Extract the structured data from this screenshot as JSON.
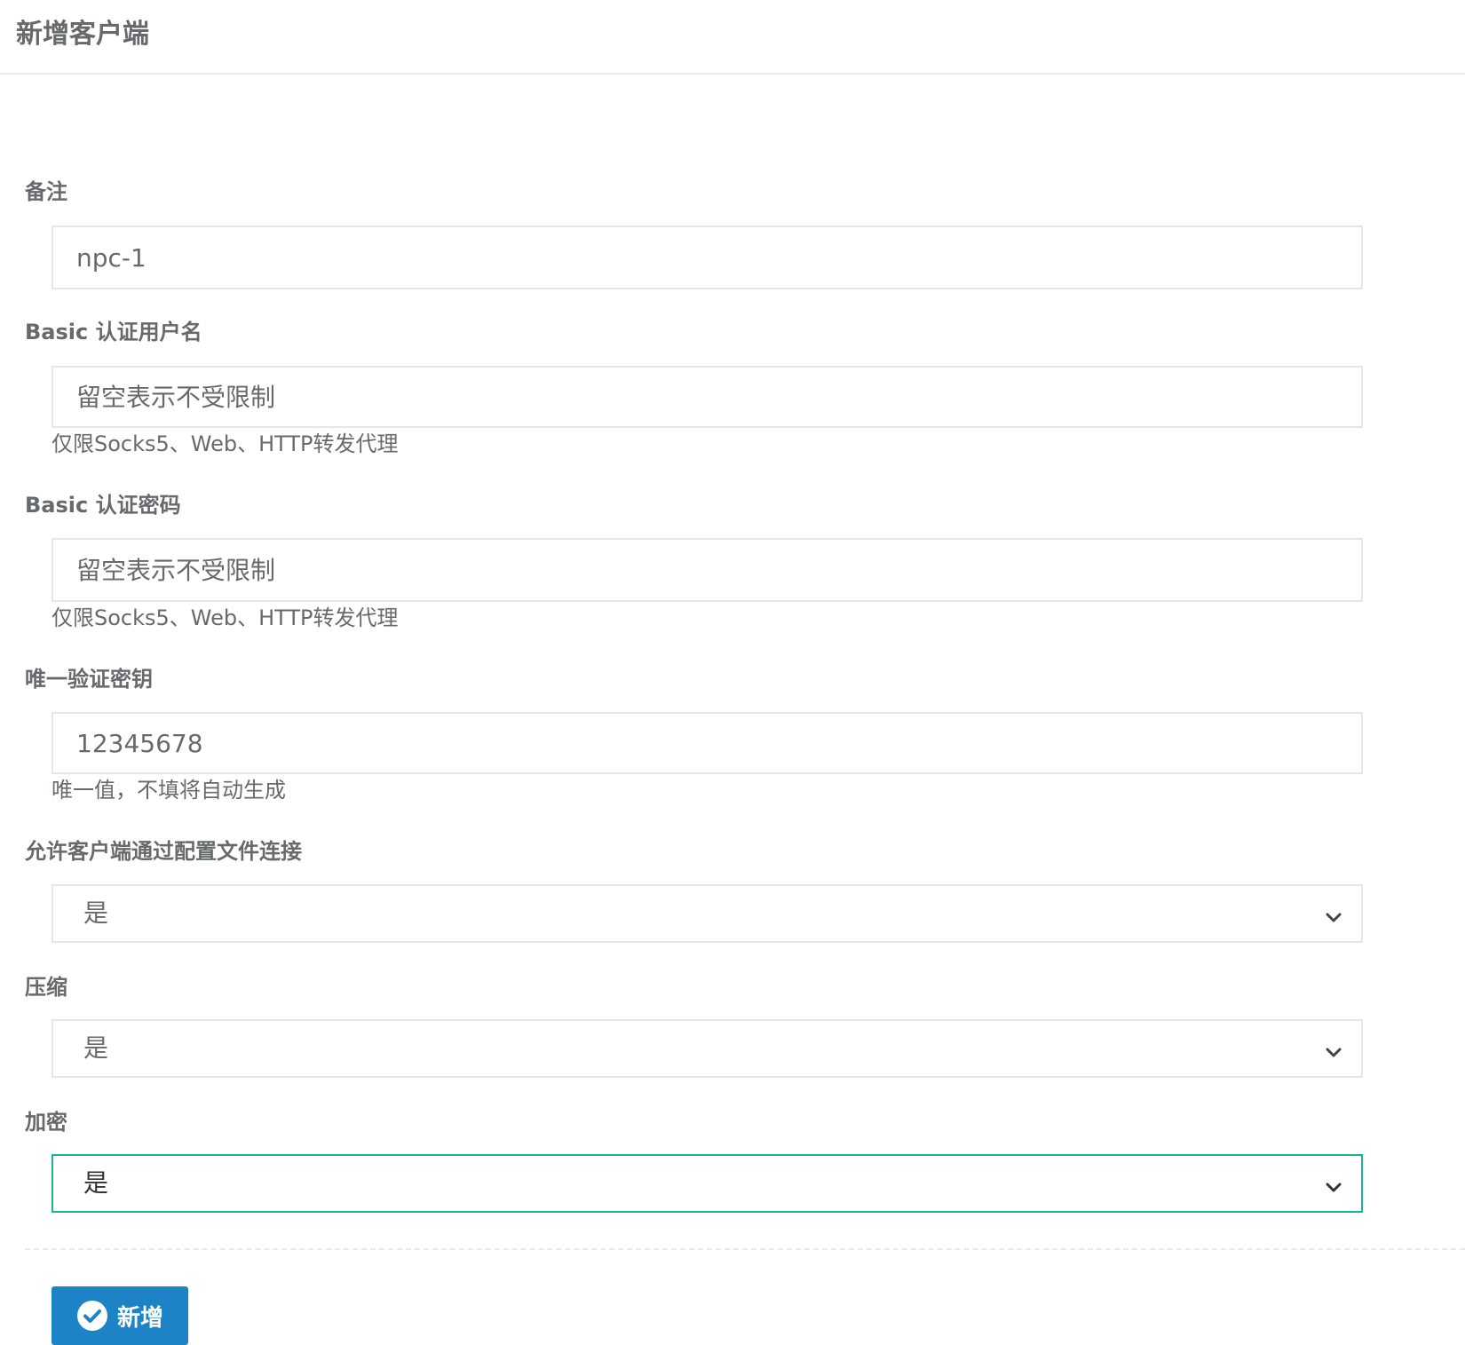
{
  "panel": {
    "title": "新增客户端"
  },
  "form": {
    "remark": {
      "label": "备注",
      "value": "npc-1"
    },
    "basic_username": {
      "label": "Basic 认证用户名",
      "placeholder": "留空表示不受限制",
      "help": "仅限Socks5、Web、HTTP转发代理"
    },
    "basic_password": {
      "label": "Basic 认证密码",
      "placeholder": "留空表示不受限制",
      "help": "仅限Socks5、Web、HTTP转发代理"
    },
    "verify_key": {
      "label": "唯一验证密钥",
      "value": "12345678",
      "help": "唯一值，不填将自动生成"
    },
    "config_conn_allow": {
      "label": "允许客户端通过配置文件连接",
      "selected": "是"
    },
    "compress": {
      "label": "压缩",
      "selected": "是"
    },
    "crypt": {
      "label": "加密",
      "selected": "是"
    }
  },
  "actions": {
    "submit_label": "新增"
  },
  "colors": {
    "primary": "#1c84c6",
    "focus_border": "#1ab394",
    "text": "#676a6c",
    "border": "#e5e6e7"
  },
  "icons": {
    "submit": "check-circle-icon",
    "select_arrow": "chevron-down-icon"
  }
}
